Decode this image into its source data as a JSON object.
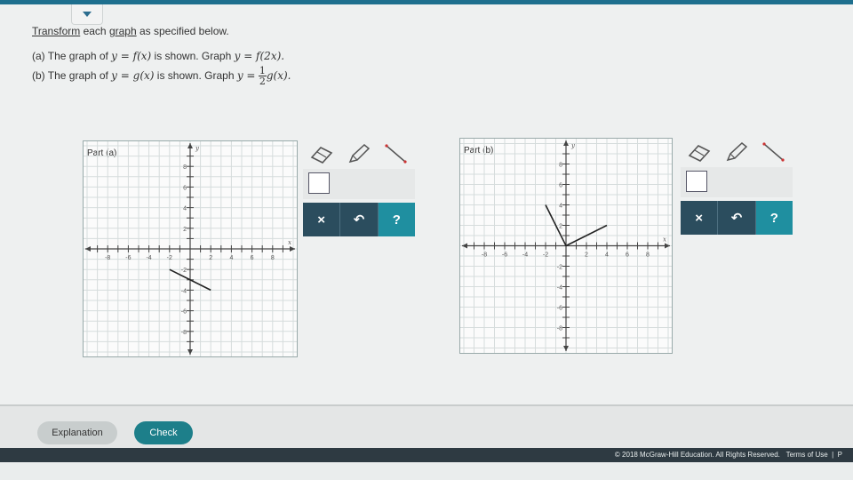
{
  "question": {
    "title_link": "Transform",
    "title_mid": " each ",
    "title_link2": "graph",
    "title_rest": " as specified below.",
    "part_a_prefix": "(a) The graph of ",
    "part_a_fx": "y = f(x)",
    "part_a_mid": " is shown. Graph ",
    "part_a_target": "y = f(2x).",
    "part_b_prefix": "(b) The graph of ",
    "part_b_gx": "y = g(x)",
    "part_b_mid": " is shown. Graph ",
    "part_b_target_lhs": "y =",
    "part_b_frac_num": "1",
    "part_b_frac_den": "2",
    "part_b_target_rhs": "g(x)."
  },
  "graph_a": {
    "label": "Part (a)",
    "x_axis_label": "x",
    "y_axis_label": "y",
    "x_ticks": [
      "-8",
      "-6",
      "-4",
      "-2",
      "2",
      "4",
      "6",
      "8"
    ],
    "y_ticks": [
      "8",
      "6",
      "4",
      "2",
      "-2",
      "-4",
      "-6",
      "-8"
    ],
    "segments": [
      {
        "from": [
          -2,
          -2
        ],
        "to": [
          2,
          -4
        ]
      }
    ]
  },
  "graph_b": {
    "label": "Part (b)",
    "x_axis_label": "x",
    "y_axis_label": "y",
    "x_ticks": [
      "-8",
      "-6",
      "-4",
      "-2",
      "2",
      "4",
      "6",
      "8"
    ],
    "y_ticks": [
      "8",
      "6",
      "4",
      "2",
      "-2",
      "-4",
      "-6",
      "-8"
    ],
    "segments": [
      {
        "from": [
          -2,
          4
        ],
        "to": [
          0,
          0
        ]
      },
      {
        "from": [
          0,
          0
        ],
        "to": [
          4,
          2
        ]
      }
    ]
  },
  "toolbox": {
    "tools": [
      "eraser-icon",
      "pencil-icon",
      "line-tool-icon"
    ],
    "clear_label": "×",
    "undo_label": "↶",
    "help_label": "?"
  },
  "footer": {
    "explanation_label": "Explanation",
    "check_label": "Check",
    "copyright": "© 2018 McGraw-Hill Education. All Rights Reserved.",
    "terms": "Terms of Use",
    "privacy": "P"
  },
  "colors": {
    "accent": "#1d7f8a",
    "toolbar_dark": "#2b4d5e",
    "top_bar": "#1e6f8e"
  }
}
